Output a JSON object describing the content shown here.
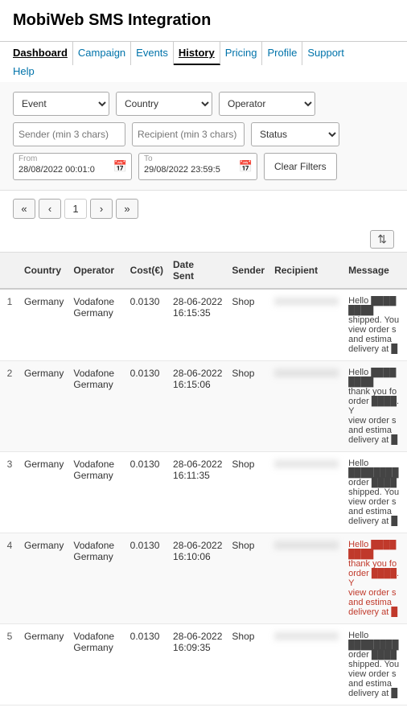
{
  "header": {
    "title": "MobiWeb SMS Integration"
  },
  "nav": {
    "items": [
      {
        "label": "Dashboard",
        "active": false
      },
      {
        "label": "Campaign",
        "active": false
      },
      {
        "label": "Events",
        "active": false
      },
      {
        "label": "History",
        "active": true
      },
      {
        "label": "Pricing",
        "active": false
      },
      {
        "label": "Profile",
        "active": false
      },
      {
        "label": "Support",
        "active": false
      }
    ],
    "second_row": [
      {
        "label": "Help"
      }
    ]
  },
  "filters": {
    "event_placeholder": "Event",
    "country_placeholder": "Country",
    "operator_placeholder": "Operator",
    "sender_placeholder": "Sender (min 3 chars)",
    "recipient_placeholder": "Recipient (min 3 chars)",
    "status_placeholder": "Status",
    "from_label": "From",
    "to_label": "To",
    "from_value": "28/08/2022 00:01:0",
    "to_value": "29/08/2022 23:59:5",
    "clear_button": "Clear Filters"
  },
  "pagination": {
    "first": "«",
    "prev": "‹",
    "page": "1",
    "next": "›",
    "last": "»"
  },
  "table": {
    "columns": [
      "",
      "Country",
      "Operator",
      "Cost(€)",
      "Date Sent",
      "Sender",
      "Recipient",
      "Message"
    ],
    "rows": [
      {
        "num": "1",
        "country": "Germany",
        "operator": "Vodafone Germany",
        "cost": "0.0130",
        "date": "28-06-2022 16:15:35",
        "sender": "Shop",
        "recipient": "XXXXXXXXXX",
        "message": "Hello ████ ████ shipped. You view order s and estima delivery at █",
        "message_red": false
      },
      {
        "num": "2",
        "country": "Germany",
        "operator": "Vodafone Germany",
        "cost": "0.0130",
        "date": "28-06-2022 16:15:06",
        "sender": "Shop",
        "recipient": "XXXXXXXXXX",
        "message": "Hello ████ ████ thank you for order ████. Yo view order s and estima delivery at █",
        "message_red": false
      },
      {
        "num": "3",
        "country": "Germany",
        "operator": "Vodafone Germany",
        "cost": "0.0130",
        "date": "28-06-2022 16:11:35",
        "sender": "Shop",
        "recipient": "XXXXXXXXXX",
        "message": "Hello ████████ order ████ shipped. You view order s and estima delivery at █",
        "message_red": false
      },
      {
        "num": "4",
        "country": "Germany",
        "operator": "Vodafone Germany",
        "cost": "0.0130",
        "date": "28-06-2022 16:10:06",
        "sender": "Shop",
        "recipient": "XXXXXXXXXX",
        "message": "Hello ████ ████ thank you for order ████. Y view order s and estima delivery at █",
        "message_red": true
      },
      {
        "num": "5",
        "country": "Germany",
        "operator": "Vodafone Germany",
        "cost": "0.0130",
        "date": "28-06-2022 16:09:35",
        "sender": "Shop",
        "recipient": "XXXXXXXXXX",
        "message": "Hello ████████ order ████ shipped. You view order s and estima delivery at █",
        "message_red": false
      }
    ]
  }
}
